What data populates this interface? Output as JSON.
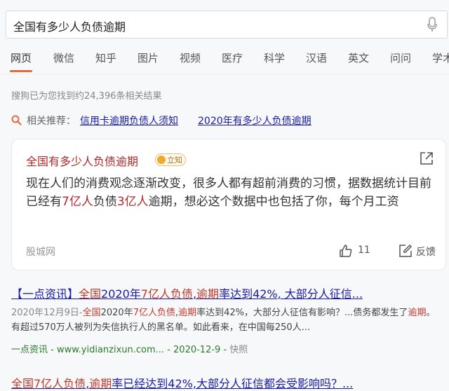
{
  "search": {
    "query": "全国有多少人负债逾期"
  },
  "tabs": [
    "网页",
    "微信",
    "知乎",
    "图片",
    "视频",
    "医疗",
    "科学",
    "汉语",
    "英文",
    "问问",
    "学术"
  ],
  "result_count": "搜狗已为您找到约24,396条相关结果",
  "related": {
    "label": "相关推荐：",
    "links": [
      "信用卡逾期负债人须知",
      "2020年有多少人负债逾期"
    ]
  },
  "card": {
    "title": "全国有多少人负债逾期",
    "badge": "立知",
    "body_parts": {
      "p1": "现在人们的消费观念逐渐改变，很多人都有超前消费的习惯，据数据统计目前已经有",
      "p2": "7亿人",
      "p3": "负债",
      "p4": "3亿人",
      "p5": "逾期，想必这个数据中也包括了你，每个月工资"
    },
    "source": "股城网",
    "likes": "11",
    "feedback": "反馈"
  },
  "result1": {
    "title_parts": {
      "a": "【一点资讯】",
      "b": "全国",
      "c": "2020年",
      "d": "7亿人负债",
      "e": ",",
      "f": "逾期",
      "g": "率达到42%, 大部分人征信..."
    },
    "snippet_parts": {
      "date": "2020年12月9日-",
      "a": "全国",
      "b": "2020年",
      "c": "7亿人负债",
      "d": ",",
      "e": "逾期",
      "f": "率达到42%，大部分人征信有影响？...债务都发生了",
      "g": "逾期",
      "h": "。有超过570万人被列为失信执行人的黑名单。如此看来，在中国每250人..."
    },
    "url": "一点资讯 - www.yidianzixun.com... - 2020-12-9 - ",
    "cache": "快照"
  },
  "result2": {
    "title_parts": {
      "a": "全国7亿人负债",
      "b": ",",
      "c": "逾期",
      "d": "率已经达到42%,大部分人征信都会受影响吗？..."
    }
  },
  "colors": {
    "accent": "#e36c3c",
    "link": "#1a1aa6",
    "highlight": "#c0392b",
    "url": "#2a7a2a"
  }
}
